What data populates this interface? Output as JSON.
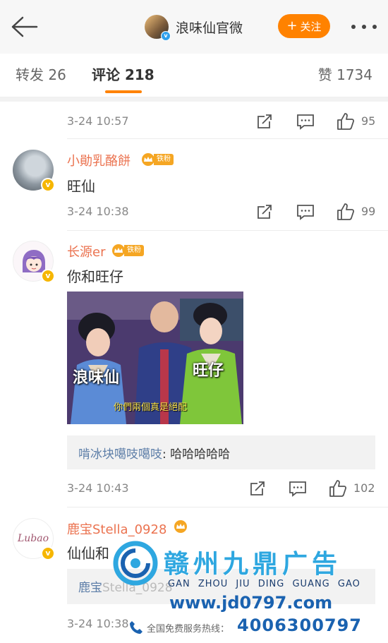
{
  "header": {
    "title": "浪味仙官微",
    "follow_label": "关注",
    "follow_plus": "+"
  },
  "tabs": {
    "repost": "转发 26",
    "comment": "评论 218",
    "like": "赞 1734"
  },
  "comments": [
    {
      "time": "3-24 10:57",
      "likes": "95"
    },
    {
      "user": "小勛乳酪餅",
      "fan_label": "铁粉",
      "text": "旺仙",
      "time": "3-24 10:38",
      "likes": "99"
    },
    {
      "user": "长源er",
      "fan_label": "铁粉",
      "text": "你和旺仔",
      "image_labels": [
        "浪味仙",
        "旺仔"
      ],
      "image_caption": "你們兩個真是絕配",
      "reply_user": "啃冰块噶吱噶吱",
      "reply_text": ": 哈哈哈哈哈",
      "time": "3-24 10:43",
      "likes": "102"
    },
    {
      "user": "鹿宝Stella_0928",
      "text": "仙仙和",
      "reply_user": "鹿宝",
      "reply_text": "Stella_0928",
      "time": "3-24 10:38",
      "avatar_text": "Lubao"
    }
  ],
  "ad": {
    "brand_cn": "赣州九鼎广告",
    "pinyin": "GAN ZHOU JIU DING GUANG GAO",
    "site": "www.jd0797.com",
    "hotline_label": "全国免费服务热线：",
    "phone": "4006300797"
  },
  "colors": {
    "accent": "#ff8200",
    "username": "#eb7350",
    "reply_name": "#5d7ea8",
    "fan_badge": "#f5a623"
  }
}
